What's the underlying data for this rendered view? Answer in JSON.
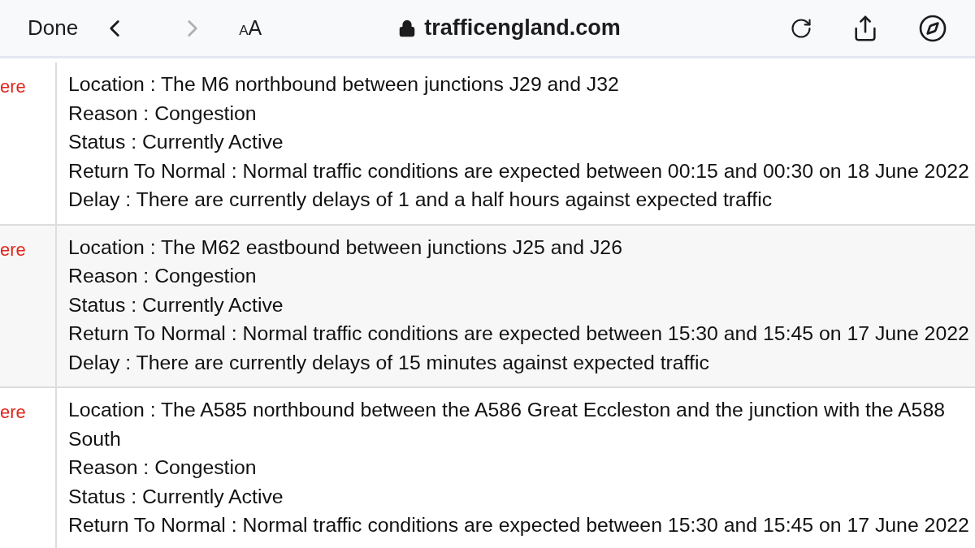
{
  "toolbar": {
    "done": "Done",
    "back": {
      "disabled": false
    },
    "forward": {
      "disabled": true
    },
    "text_size": {
      "small": "A",
      "large": "A"
    },
    "url": "trafficengland.com"
  },
  "incidents": [
    {
      "link": "ere",
      "lines": [
        "Location : The M6 northbound between junctions J29 and J32",
        "Reason : Congestion",
        "Status : Currently Active",
        "Return To Normal : Normal traffic conditions are expected between 00:15 and 00:30 on 18 June 2022",
        "Delay : There are currently delays of 1 and a half hours against expected traffic"
      ]
    },
    {
      "link": "ere",
      "lines": [
        "Location : The M62 eastbound between junctions J25 and J26",
        "Reason : Congestion",
        "Status : Currently Active",
        "Return To Normal : Normal traffic conditions are expected between 15:30 and 15:45 on 17 June 2022",
        "Delay : There are currently delays of 15 minutes against expected traffic"
      ]
    },
    {
      "link": "ere",
      "lines": [
        "Location : The A585 northbound between the A586 Great Eccleston and the junction with the A588 South",
        "Reason : Congestion",
        "Status : Currently Active",
        "Return To Normal : Normal traffic conditions are expected between 15:30 and 15:45 on 17 June 2022"
      ]
    }
  ]
}
